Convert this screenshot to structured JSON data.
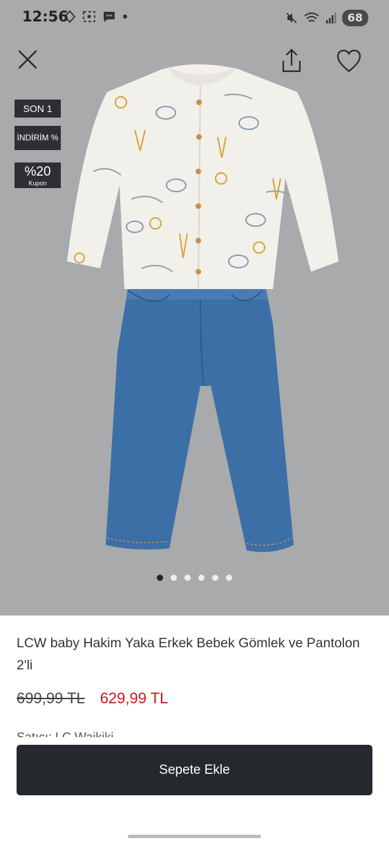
{
  "status_bar": {
    "time": "12:56",
    "battery": "68"
  },
  "hero": {
    "badges": {
      "son": "SON 1",
      "indirim": "İNDİRİM %",
      "kupon_big": "%20",
      "kupon_small": "Kupon"
    },
    "page_count": 6,
    "active_page": 1
  },
  "product": {
    "title": "LCW baby Hakim Yaka Erkek Bebek Gömlek ve Pantolon 2'li",
    "old_price": "699,99 TL",
    "new_price": "629,99 TL",
    "seller": "Satıcı: LC Waikiki"
  },
  "bottom": {
    "cart_label": "Sepete Ekle"
  },
  "colors": {
    "hero_bg": "#a9aaac",
    "badge_bg": "#2d2f33",
    "sale_price": "#c8161d",
    "cart_button": "#25282c"
  }
}
